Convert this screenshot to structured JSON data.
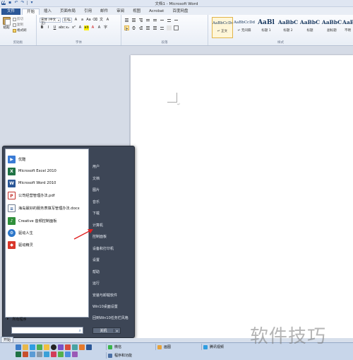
{
  "window": {
    "title": "文档1 - Microsoft Word"
  },
  "ribbon": {
    "tabs": [
      "文件",
      "开始",
      "插入",
      "页面布局",
      "引用",
      "邮件",
      "审阅",
      "视图",
      "Acrobat",
      "百度网盘"
    ],
    "clipboard": {
      "paste": "粘贴",
      "cut": "剪切",
      "copy": "复制",
      "format_painter": "格式刷",
      "label": "剪贴板"
    },
    "font": {
      "name": "宋体 (中文正)",
      "size": "五号",
      "label": "字体"
    },
    "paragraph": {
      "label": "段落"
    },
    "styles": {
      "label": "样式",
      "items": [
        {
          "sample": "AaBbCcDd",
          "name": "↵ 正文"
        },
        {
          "sample": "AaBbCcDd",
          "name": "↵ 无间隔"
        },
        {
          "sample": "AaBl",
          "name": "标题 1"
        },
        {
          "sample": "AaBbC",
          "name": "标题 2"
        },
        {
          "sample": "AaBbC",
          "name": "标题"
        },
        {
          "sample": "AaBbC",
          "name": "副标题"
        },
        {
          "sample": "AaBb",
          "name": "不明"
        }
      ]
    }
  },
  "document": {
    "paragraph_mark": "↵"
  },
  "start_menu": {
    "programs": [
      {
        "label": "优酷",
        "icon": "youku-icon",
        "color": "#3a7bd5"
      },
      {
        "label": "Microsoft Excel 2010",
        "icon": "excel-icon",
        "color": "#1f7244"
      },
      {
        "label": "Microsoft Word 2010",
        "icon": "word-icon",
        "color": "#2b5797"
      },
      {
        "label": "公司经营管理办法.pdf",
        "icon": "pdf-icon",
        "color": "#c4302b"
      },
      {
        "label": "海岛最好的服务表填写管理办法.docx",
        "icon": "docx-icon",
        "color": "#6d7b8d"
      },
      {
        "label": "Creative 音频控制面板",
        "icon": "creative-icon",
        "color": "#2f8f3a"
      },
      {
        "label": "驱动人生",
        "icon": "driver-icon",
        "color": "#2c76c9"
      },
      {
        "label": "驱动精灵",
        "icon": "driver-genius-icon",
        "color": "#d9372b"
      }
    ],
    "all_programs": "所有程序",
    "places": [
      "用户",
      "文档",
      "图片",
      "音乐",
      "下载",
      "计算机",
      "控制面板",
      "设备和打印机",
      "设置",
      "帮助",
      "运行",
      "安装与卸载软件",
      "Win10桌面设置",
      "回到Win10任务栏风格"
    ],
    "shutdown": "关机"
  },
  "taskbar": {
    "start": "开始",
    "tasks": [
      {
        "label": "微信",
        "color": "#3ab54a"
      },
      {
        "label": "画图",
        "color": "#e6a23c"
      },
      {
        "label": "腾讯视频",
        "color": "#2f9de0"
      },
      {
        "label": "程序和功能",
        "color": "#4a6fa5"
      }
    ]
  },
  "watermark": "软件技巧"
}
